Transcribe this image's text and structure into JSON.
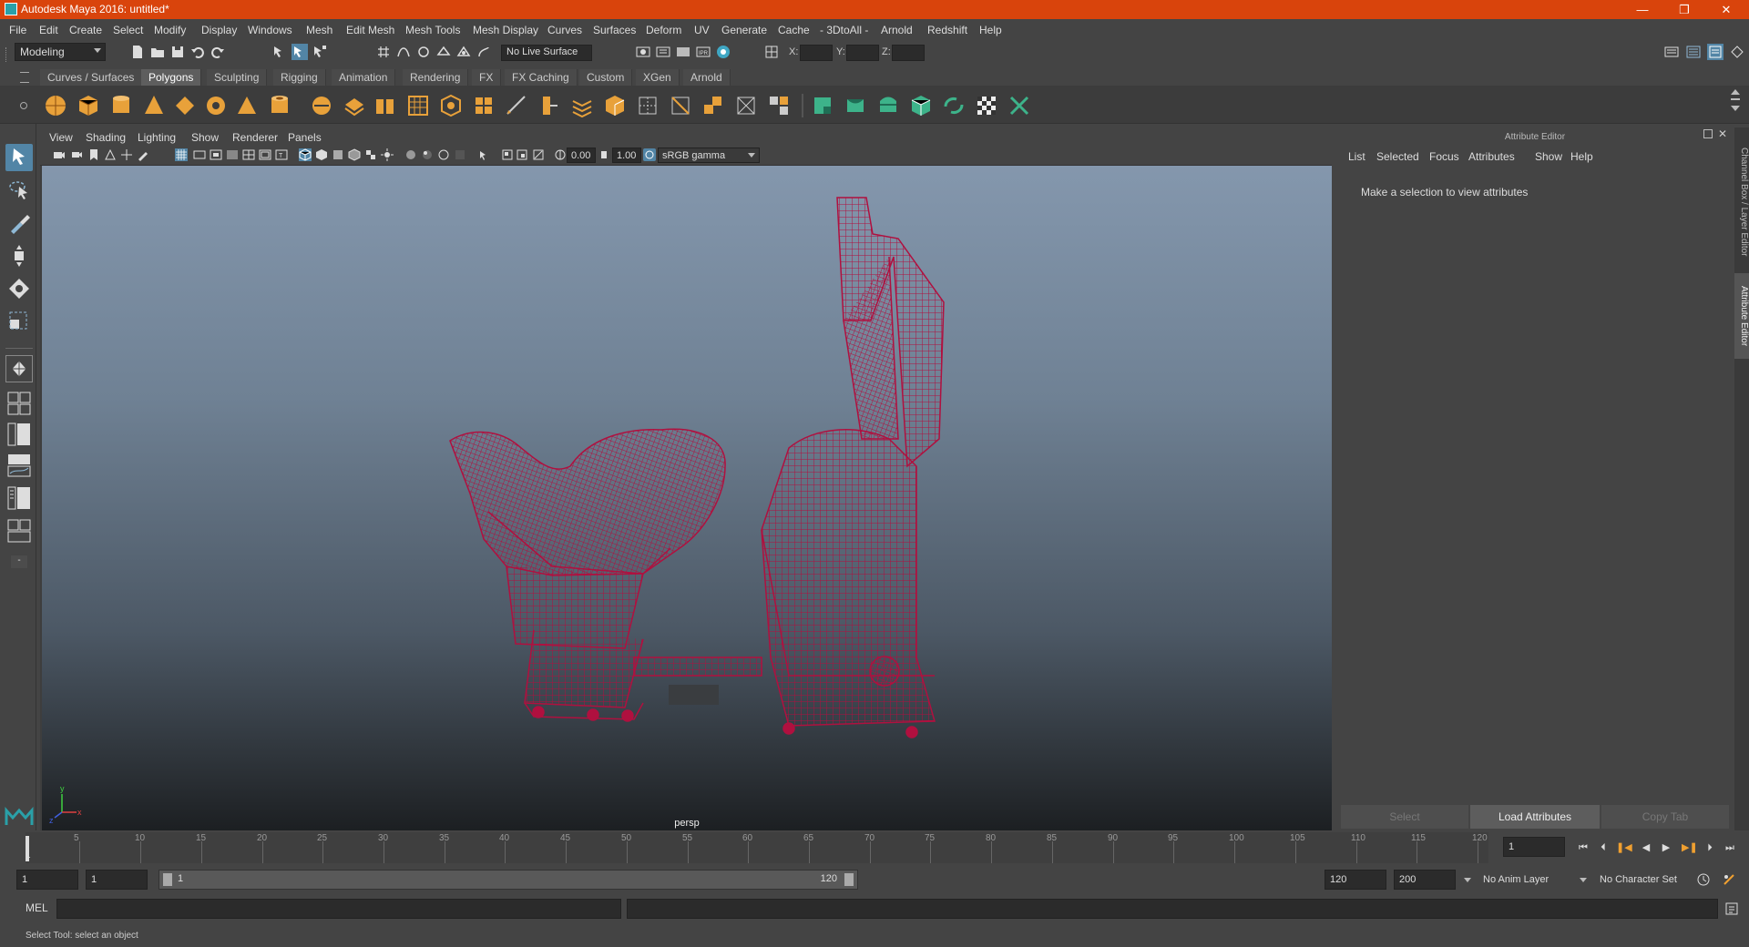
{
  "window": {
    "title": "Autodesk Maya 2016: untitled*"
  },
  "menubar": [
    "File",
    "Edit",
    "Create",
    "Select",
    "Modify",
    "Display",
    "Windows",
    "Mesh",
    "Edit Mesh",
    "Mesh Tools",
    "Mesh Display",
    "Curves",
    "Surfaces",
    "Deform",
    "UV",
    "Generate",
    "Cache",
    "- 3DtoAll -",
    "Arnold",
    "Redshift",
    "Help"
  ],
  "status": {
    "mode": "Modeling",
    "live_surface": "No Live Surface",
    "x_label": "X:",
    "y_label": "Y:",
    "z_label": "Z:"
  },
  "shelf_tabs": [
    "Curves / Surfaces",
    "Polygons",
    "Sculpting",
    "Rigging",
    "Animation",
    "Rendering",
    "FX",
    "FX Caching",
    "Custom",
    "XGen",
    "Arnold"
  ],
  "viewport": {
    "menu": [
      "View",
      "Shading",
      "Lighting",
      "Show",
      "Renderer",
      "Panels"
    ],
    "exposure": "0.00",
    "gamma": "1.00",
    "color_space": "sRGB gamma",
    "camera": "persp",
    "axis_y": "y",
    "axis_x": "x",
    "axis_z": "z"
  },
  "attribute_editor": {
    "title": "Attribute Editor",
    "menu": [
      "List",
      "Selected",
      "Focus",
      "Attributes",
      "Show",
      "Help"
    ],
    "message": "Make a selection to view attributes",
    "buttons": [
      "Select",
      "Load Attributes",
      "Copy Tab"
    ]
  },
  "side_tabs": [
    "Channel Box / Layer Editor",
    "Attribute Editor"
  ],
  "timeline": {
    "ticks": [
      5,
      10,
      15,
      20,
      25,
      30,
      35,
      40,
      45,
      50,
      55,
      60,
      65,
      70,
      75,
      80,
      85,
      90,
      95,
      100,
      105,
      110,
      115,
      120
    ],
    "current_marker": "1",
    "current_frame": "1"
  },
  "range": {
    "start": "1",
    "playback_start": "1",
    "slider_start": "1",
    "slider_end": "120",
    "playback_end": "120",
    "end": "200",
    "anim_layer": "No Anim Layer",
    "character_set": "No Character Set"
  },
  "command": {
    "label": "MEL"
  },
  "help": {
    "text": "Select Tool: select an object"
  },
  "colors": {
    "title_bar": "#d9440c",
    "wireframe": "#b0103f",
    "selected_tool": "#5285a6",
    "shelf_orange": "#e8a13a",
    "shelf_green": "#3db38a"
  }
}
